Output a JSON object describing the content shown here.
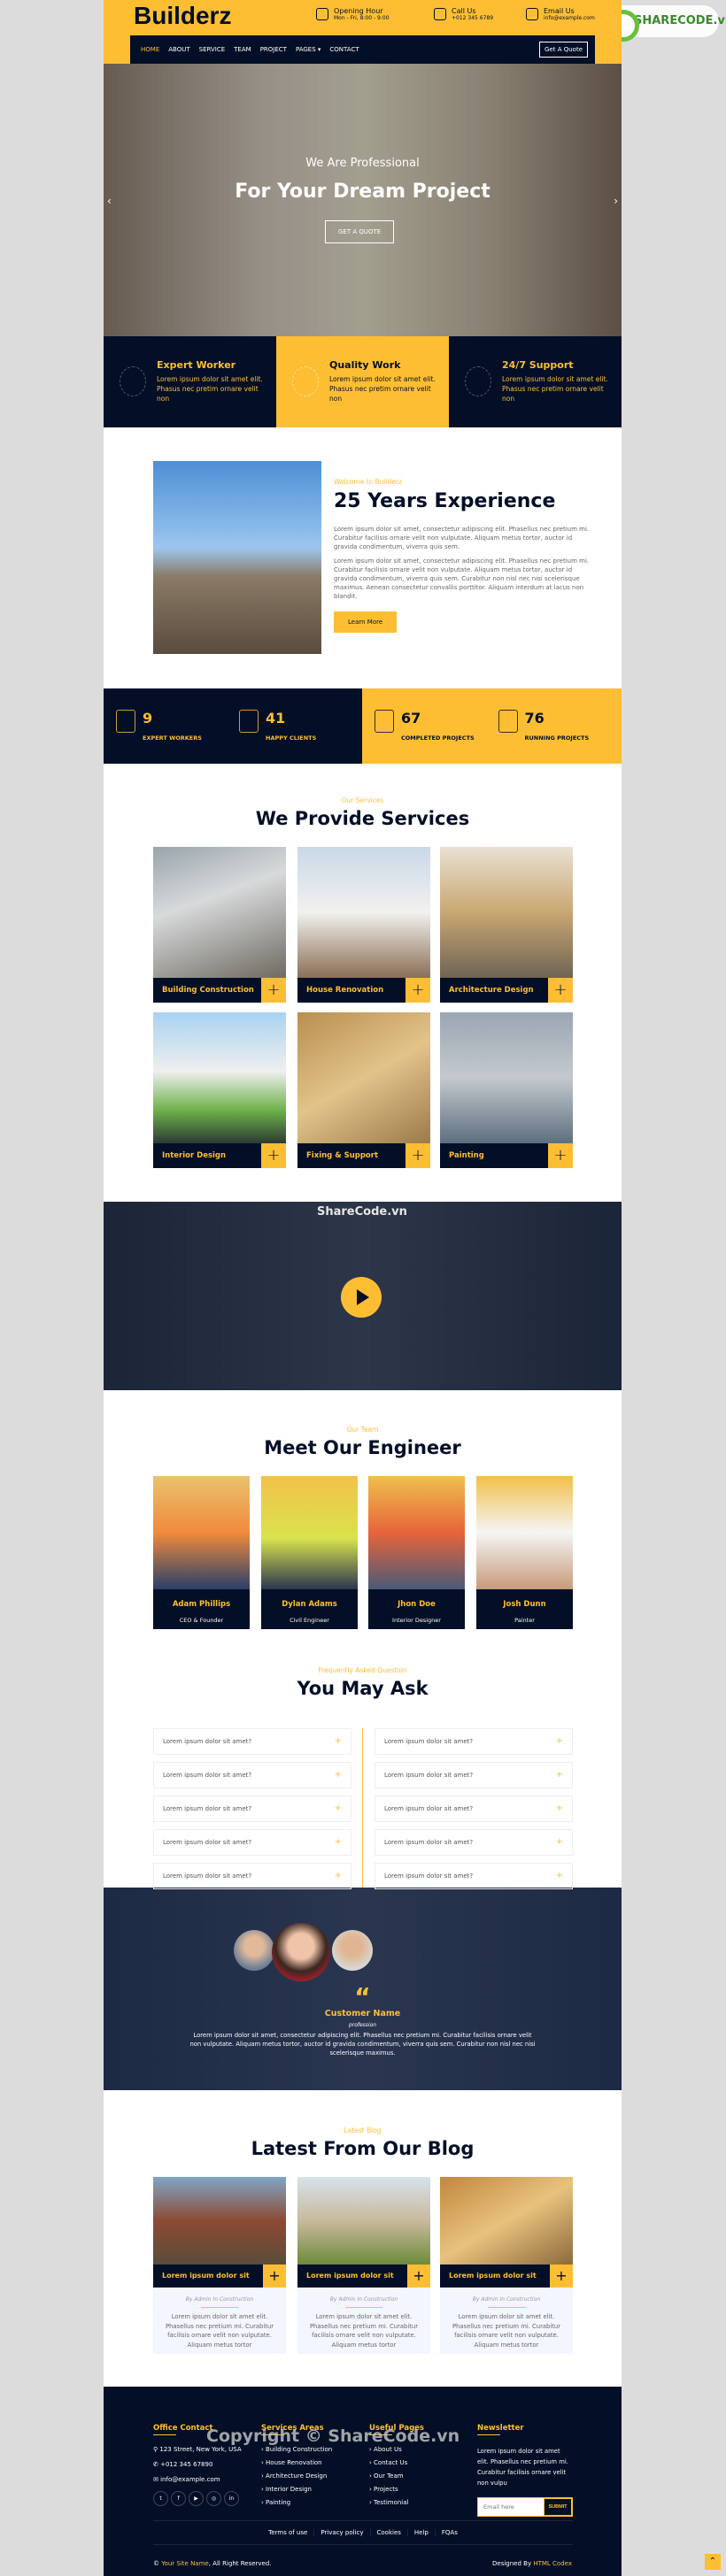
{
  "brand": "Builderz",
  "watermark_logo": "SHARECODE.vn",
  "header": {
    "info": [
      {
        "icon": "calendar-clock-icon",
        "title": "Opening Hour",
        "text": "Mon - Fri, 8:00 - 9:00"
      },
      {
        "icon": "phone-icon",
        "title": "Call Us",
        "text": "+012 345 6789"
      },
      {
        "icon": "email-icon",
        "title": "Email Us",
        "text": "info@example.com"
      }
    ]
  },
  "nav": {
    "items": [
      "HOME",
      "ABOUT",
      "SERVICE",
      "TEAM",
      "PROJECT",
      "PAGES ▾",
      "CONTACT"
    ],
    "active": "HOME",
    "cta": "Get A Quote"
  },
  "hero": {
    "subtitle": "We Are Professional",
    "title": "For Your Dream Project",
    "button": "GET A QUOTE"
  },
  "features": [
    {
      "title": "Expert Worker",
      "text": "Lorem ipsum dolor sit amet elit. Phasus nec pretim ornare velit non",
      "icon": "worker-icon"
    },
    {
      "title": "Quality Work",
      "text": "Lorem ipsum dolor sit amet elit. Phasus nec pretim ornare velit non",
      "icon": "building-icon"
    },
    {
      "title": "24/7 Support",
      "text": "Lorem ipsum dolor sit amet elit. Phasus nec pretim ornare velit non",
      "icon": "support-icon"
    }
  ],
  "about": {
    "kicker": "Welcome to Builderz",
    "title": "25 Years Experience",
    "p1": "Lorem ipsum dolor sit amet, consectetur adipiscing elit. Phasellus nec pretium mi. Curabitur facilisis ornare velit non vulputate. Aliquam metus tortor, auctor id gravida condimentum, viverra quis sem.",
    "p2": "Lorem ipsum dolor sit amet, consectetur adipiscing elit. Phasellus nec pretium mi. Curabitur facilisis ornare velit non vulputate. Aliquam metus tortor, auctor id gravida condimentum, viverra quis sem. Curabitur non nisl nec nisi scelerisque maximus. Aenean consectetur convallis porttitor. Aliquam interdum at lacus non blandit.",
    "button": "Learn More"
  },
  "stats": [
    {
      "value": "9",
      "label": "EXPERT WORKERS"
    },
    {
      "value": "41",
      "label": "HAPPY CLIENTS"
    },
    {
      "value": "67",
      "label": "COMPLETED PROJECTS"
    },
    {
      "value": "76",
      "label": "RUNNING PROJECTS"
    }
  ],
  "services": {
    "kicker": "Our Services",
    "title": "We Provide Services",
    "items": [
      "Building Construction",
      "House Renovation",
      "Architecture Design",
      "Interior Design",
      "Fixing & Support",
      "Painting"
    ]
  },
  "video_watermark": "ShareCode.vn",
  "team": {
    "kicker": "Our Team",
    "title": "Meet Our Engineer",
    "members": [
      {
        "name": "Adam Phillips",
        "role": "CEO & Founder"
      },
      {
        "name": "Dylan Adams",
        "role": "Civil Engineer"
      },
      {
        "name": "Jhon Doe",
        "role": "Interior Designer"
      },
      {
        "name": "Josh Dunn",
        "role": "Painter"
      }
    ]
  },
  "faq": {
    "kicker": "Frequently Asked Question",
    "title": "You May Ask",
    "left": [
      "Lorem ipsum dolor sit amet?",
      "Lorem ipsum dolor sit amet?",
      "Lorem ipsum dolor sit amet?",
      "Lorem ipsum dolor sit amet?",
      "Lorem ipsum dolor sit amet?"
    ],
    "right": [
      "Lorem ipsum dolor sit amet?",
      "Lorem ipsum dolor sit amet?",
      "Lorem ipsum dolor sit amet?",
      "Lorem ipsum dolor sit amet?",
      "Lorem ipsum dolor sit amet?"
    ]
  },
  "testimonial": {
    "quote_mark": "“",
    "name": "Customer Name",
    "profession": "profession",
    "text": "Lorem ipsum dolor sit amet, consectetur adipiscing elit. Phasellus nec pretium mi. Curabitur facilisis ornare velit non vulputate. Aliquam metus tortor, auctor id gravida condimentum, viverra quis sem. Curabitur non nisl nec nisi scelerisque maximus."
  },
  "blog": {
    "kicker": "Latest Blog",
    "title": "Latest From Our Blog",
    "posts": [
      {
        "title": "Lorem ipsum dolor sit",
        "meta": "By Admin   In Construction",
        "text": "Lorem ipsum dolor sit amet elit. Phasellus nec pretium mi. Curabitur facilisis ornare velit non vulputate. Aliquam metus tortor"
      },
      {
        "title": "Lorem ipsum dolor sit",
        "meta": "By Admin   In Construction",
        "text": "Lorem ipsum dolor sit amet elit. Phasellus nec pretium mi. Curabitur facilisis ornare velit non vulputate. Aliquam metus tortor"
      },
      {
        "title": "Lorem ipsum dolor sit",
        "meta": "By Admin   In Construction",
        "text": "Lorem ipsum dolor sit amet elit. Phasellus nec pretium mi. Curabitur facilisis ornare velit non vulputate. Aliquam metus tortor"
      }
    ]
  },
  "footer": {
    "office": {
      "title": "Office Contact",
      "address": "123 Street, New York, USA",
      "phone": "+012 345 67890",
      "email": "info@example.com",
      "social": [
        "twitter",
        "facebook",
        "youtube",
        "instagram",
        "linkedin"
      ]
    },
    "services": {
      "title": "Services Areas",
      "links": [
        "Building Construction",
        "House Renovation",
        "Architecture Design",
        "Interior Design",
        "Painting"
      ]
    },
    "pages": {
      "title": "Useful Pages",
      "links": [
        "About Us",
        "Contact Us",
        "Our Team",
        "Projects",
        "Testimonial"
      ]
    },
    "newsletter": {
      "title": "Newsletter",
      "text": "Lorem ipsum dolor sit amet elit. Phasellus nec pretium mi. Curabitur facilisis ornare velit non vulpu",
      "placeholder": "Email here",
      "button": "SUBMIT"
    },
    "links": [
      "Terms of use",
      "Privacy policy",
      "Cookies",
      "Help",
      "FQAs"
    ],
    "copyright_prefix": "© ",
    "site_name": "Your Site Name",
    "copyright_suffix": ", All Right Reserved.",
    "designed_prefix": "Designed By ",
    "designer": "HTML Codex",
    "watermark": "Copyright © ShareCode.vn"
  },
  "colors": {
    "accent": "#fdbe33",
    "navy": "#030f27"
  }
}
